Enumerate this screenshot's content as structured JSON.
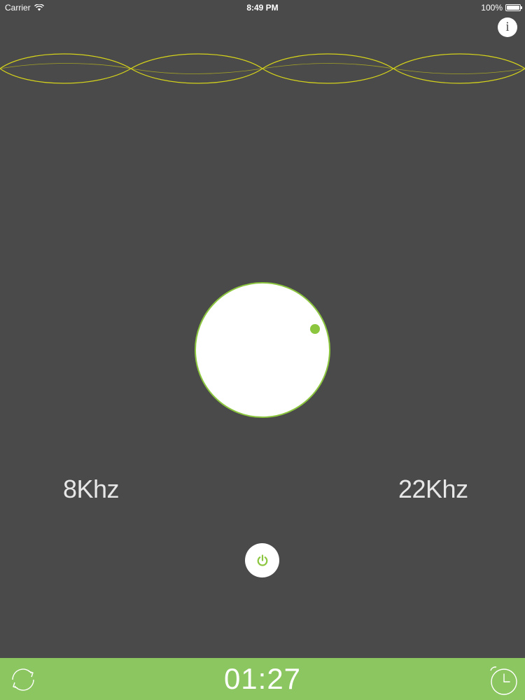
{
  "status_bar": {
    "carrier": "Carrier",
    "time": "8:49 PM",
    "battery": "100%"
  },
  "info_button": {
    "label": "i"
  },
  "frequency": {
    "min_label": "8Khz",
    "max_label": "22Khz"
  },
  "timer": {
    "value": "01:27"
  },
  "icons": {
    "wifi": "wifi-icon",
    "battery": "battery-icon",
    "info": "info-icon",
    "power": "power-icon",
    "repeat": "repeat-icon",
    "clock": "clock-icon"
  },
  "colors": {
    "background": "#4a4a4b",
    "accent_green": "#8cc63f",
    "bottom_bar": "#8cc661",
    "wave": "#d4d21a"
  }
}
